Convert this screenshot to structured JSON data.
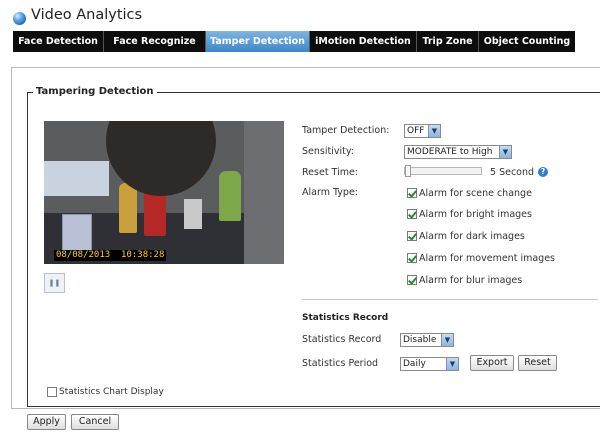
{
  "app": {
    "title": "Video Analytics"
  },
  "tabs": [
    {
      "label": "Face Detection",
      "active": false
    },
    {
      "label": "Face Recognize",
      "active": false
    },
    {
      "label": "Tamper Detection",
      "active": true
    },
    {
      "label": "iMotion Detection",
      "active": false
    },
    {
      "label": "Trip Zone",
      "active": false
    },
    {
      "label": "Object Counting",
      "active": false
    }
  ],
  "section": {
    "legend": "Tampering Detection"
  },
  "video": {
    "timestamp": "08/08/2013  10:38:28"
  },
  "settings": {
    "tamper_detection": {
      "label": "Tamper Detection:",
      "value": "OFF"
    },
    "sensitivity": {
      "label": "Sensitivity:",
      "value": "MODERATE to High"
    },
    "reset_time": {
      "label": "Reset Time:",
      "value_text": "5 Second",
      "slider_fraction": 0.0
    },
    "alarm_type": {
      "label": "Alarm Type:",
      "options": [
        {
          "label": "Alarm for scene change",
          "checked": true
        },
        {
          "label": "Alarm for bright images",
          "checked": true
        },
        {
          "label": "Alarm for dark images",
          "checked": true
        },
        {
          "label": "Alarm for movement images",
          "checked": true
        },
        {
          "label": "Alarm for blur images",
          "checked": true
        }
      ]
    }
  },
  "statistics": {
    "title": "Statistics Record",
    "record": {
      "label": "Statistics Record",
      "value": "Disable"
    },
    "period": {
      "label": "Statistics Period",
      "value": "Daily"
    },
    "export_label": "Export",
    "reset_label": "Reset",
    "chart_display": {
      "label": "Statistics Chart Display",
      "checked": false
    }
  },
  "footer": {
    "apply_label": "Apply",
    "cancel_label": "Cancel"
  },
  "icons": {
    "logo": "globe-icon",
    "help": "help-icon",
    "pause": "pause-icon",
    "dropdown": "chevron-down-icon"
  },
  "colors": {
    "tab_bar": "#0d0d0d",
    "tab_active": "#5a9fd8",
    "help": "#2f7fd3"
  }
}
